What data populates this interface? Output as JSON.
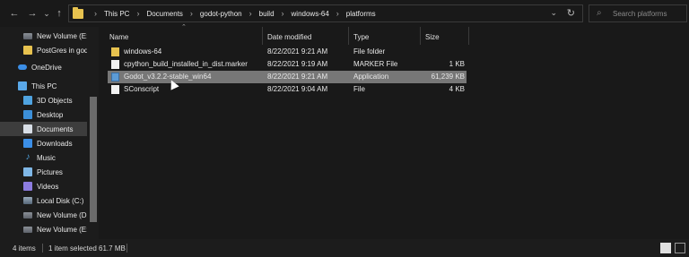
{
  "nav_buttons": {
    "back": "←",
    "forward": "→",
    "recent": "⌄",
    "up": "↑"
  },
  "address": {
    "crumbs": [
      "This PC",
      "Documents",
      "godot-python",
      "build",
      "windows-64",
      "platforms"
    ],
    "separator": "›",
    "dropdown": "⌄",
    "refresh": "↻"
  },
  "search": {
    "placeholder": "Search platforms",
    "icon": "⌕"
  },
  "sidebar": {
    "items": [
      {
        "label": "New Volume (E:)",
        "icon": "drive-icon"
      },
      {
        "label": "PostGres in godc",
        "icon": "folder-icon"
      },
      {
        "label": "OneDrive",
        "icon": "cloud-icon"
      },
      {
        "label": "This PC",
        "icon": "pc-icon"
      },
      {
        "label": "3D Objects",
        "icon": "objects-icon"
      },
      {
        "label": "Desktop",
        "icon": "desktop-icon"
      },
      {
        "label": "Documents",
        "icon": "documents-icon"
      },
      {
        "label": "Downloads",
        "icon": "downloads-icon"
      },
      {
        "label": "Music",
        "icon": "music-icon"
      },
      {
        "label": "Pictures",
        "icon": "pictures-icon"
      },
      {
        "label": "Videos",
        "icon": "videos-icon"
      },
      {
        "label": "Local Disk (C:)",
        "icon": "local-disk-icon"
      },
      {
        "label": "New Volume (D:",
        "icon": "drive-icon"
      },
      {
        "label": "New Volume (E:)",
        "icon": "drive-icon"
      }
    ],
    "selected": "Documents"
  },
  "columns": {
    "name": "Name",
    "date": "Date modified",
    "type": "Type",
    "size": "Size"
  },
  "files": [
    {
      "name": "windows-64",
      "date": "8/22/2021 9:21 AM",
      "type": "File folder",
      "size": ""
    },
    {
      "name": "cpython_build_installed_in_dist.marker",
      "date": "8/22/2021 9:19 AM",
      "type": "MARKER File",
      "size": "1 KB"
    },
    {
      "name": "Godot_v3.2.2-stable_win64",
      "date": "8/22/2021 9:21 AM",
      "type": "Application",
      "size": "61,239 KB"
    },
    {
      "name": "SConscript",
      "date": "8/22/2021 9:04 AM",
      "type": "File",
      "size": "4 KB"
    }
  ],
  "status": {
    "count": "4 items",
    "selection": "1 item selected  61.7 MB"
  },
  "colors": {
    "background": "#191919",
    "selected_row": "#777777",
    "folder": "#e7c24f"
  }
}
